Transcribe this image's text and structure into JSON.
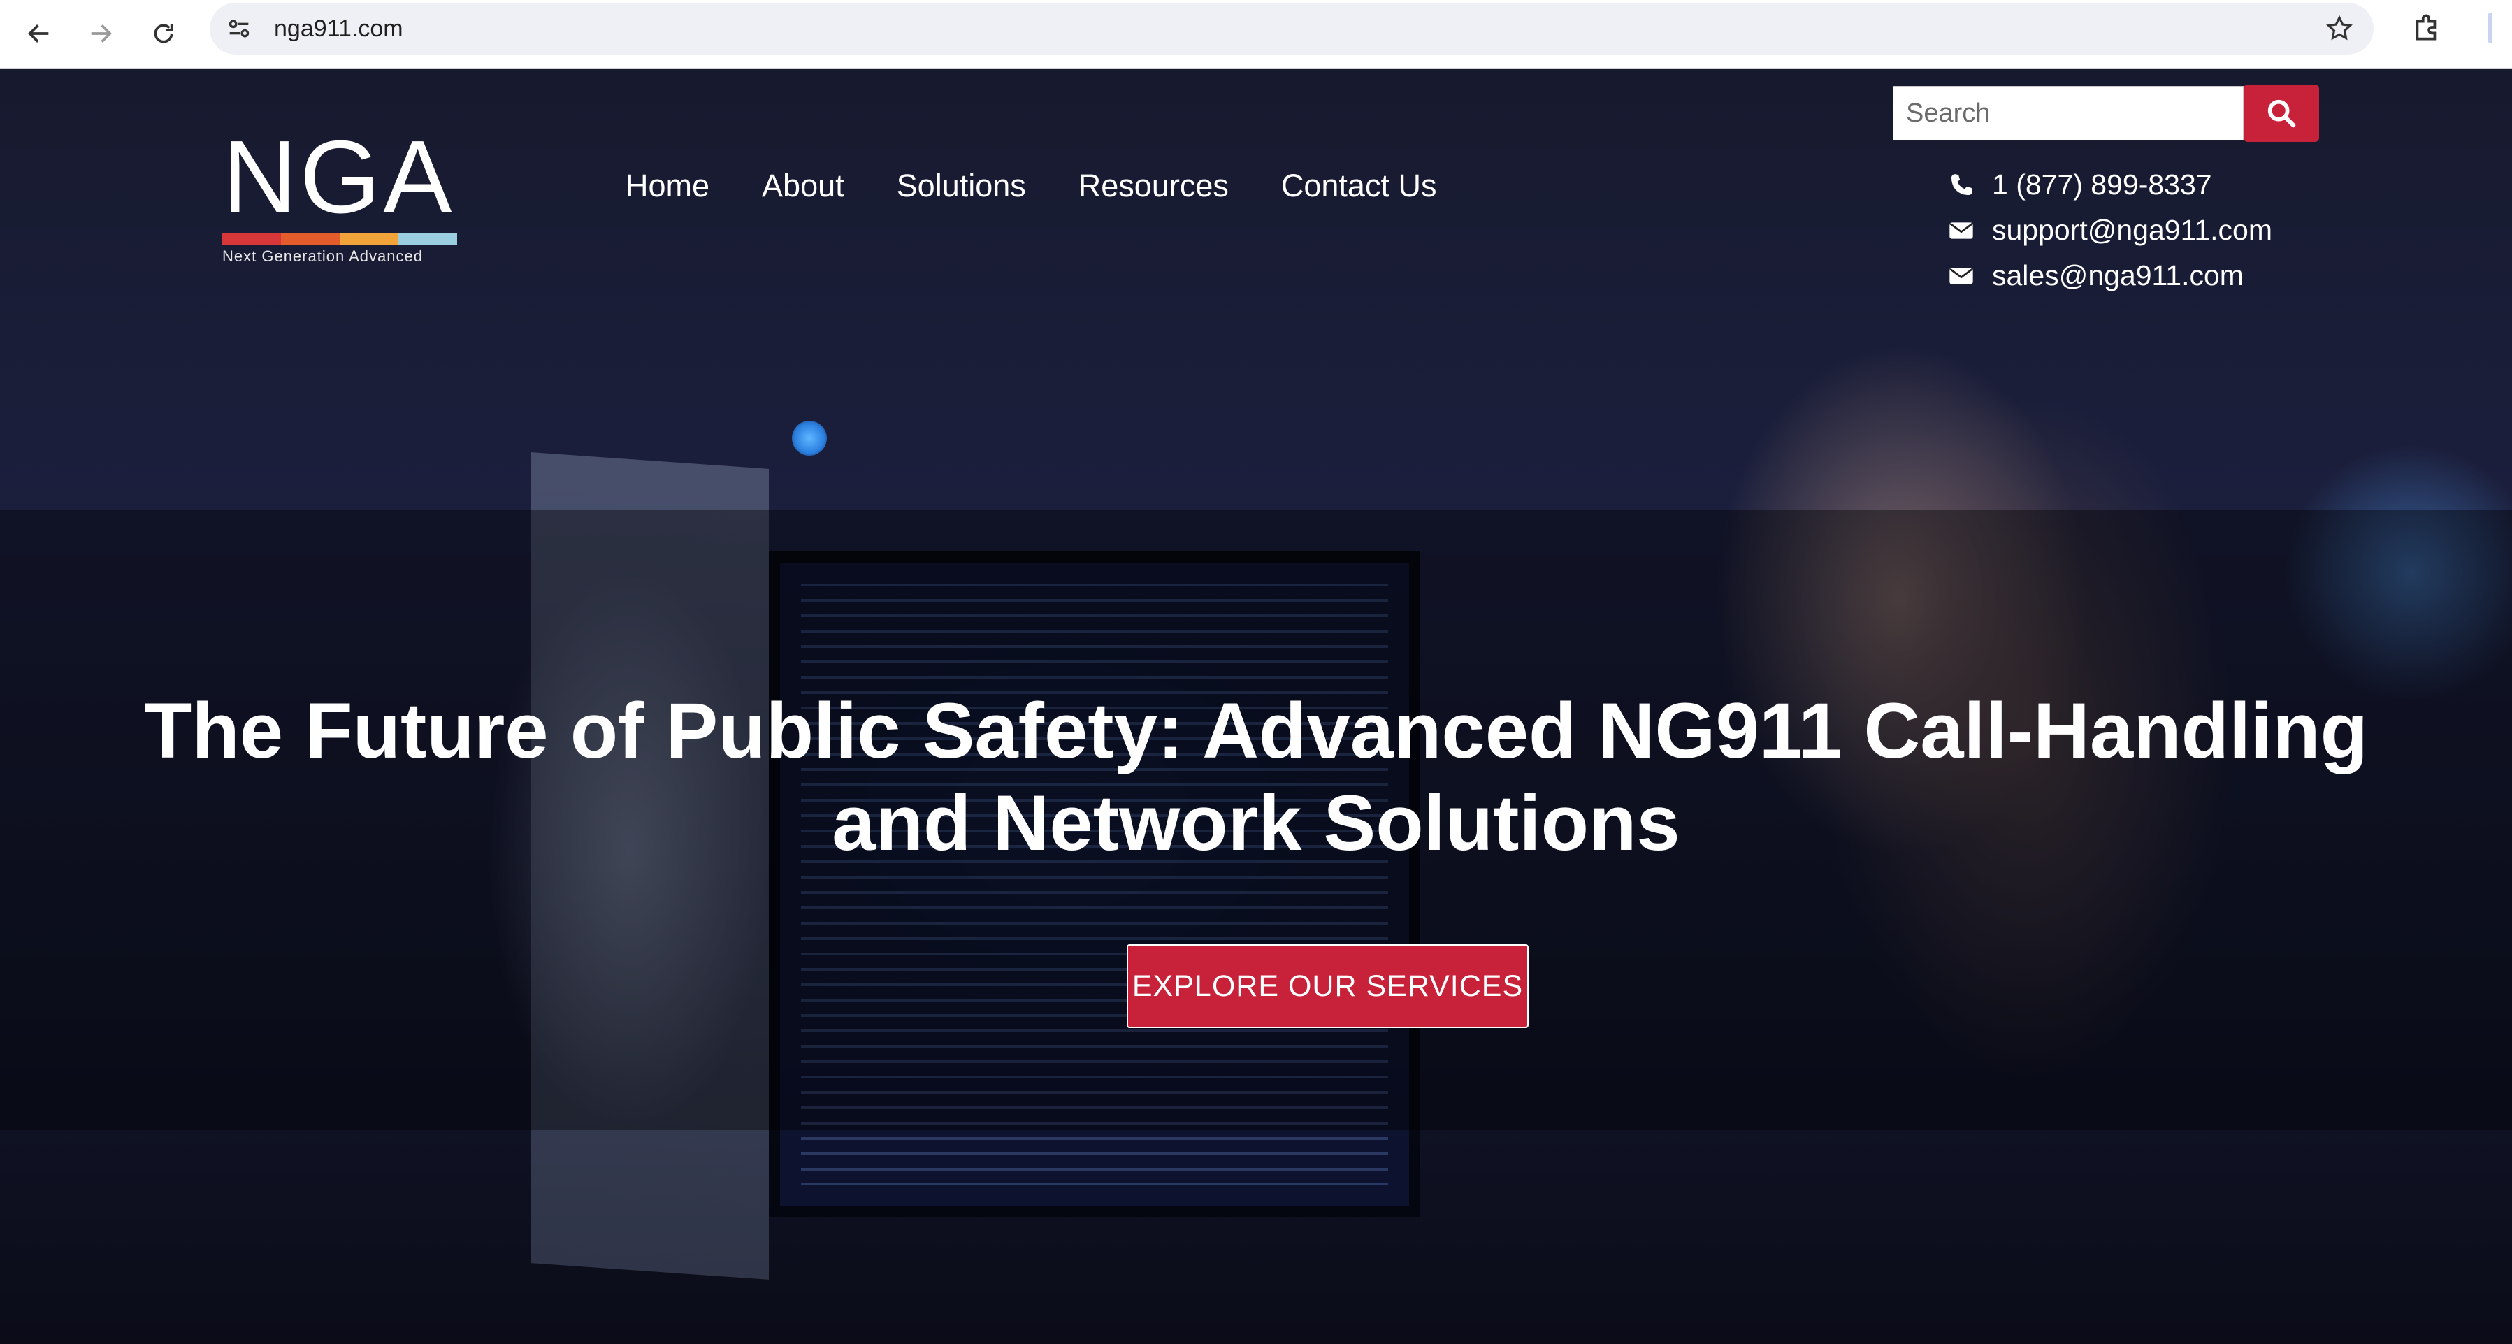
{
  "browser": {
    "url": "nga911.com"
  },
  "logo": {
    "letters": "NGA",
    "tagline": "Next Generation Advanced",
    "bar_colors": [
      "#d8373a",
      "#e45c2b",
      "#f2a33a",
      "#9bcde0"
    ]
  },
  "nav": {
    "items": [
      {
        "label": "Home"
      },
      {
        "label": "About"
      },
      {
        "label": "Solutions"
      },
      {
        "label": "Resources"
      },
      {
        "label": "Contact Us"
      }
    ]
  },
  "search": {
    "placeholder": "Search"
  },
  "contact": {
    "phone": "1 (877) 899-8337",
    "support_email": "support@nga911.com",
    "sales_email": "sales@nga911.com"
  },
  "hero": {
    "headline_line1": "The Future of Public Safety: Advanced NG911 Call-Handling",
    "headline_line2": "and Network Solutions",
    "cta_label": "EXPLORE OUR SERVICES"
  },
  "colors": {
    "accent": "#c8223a"
  }
}
